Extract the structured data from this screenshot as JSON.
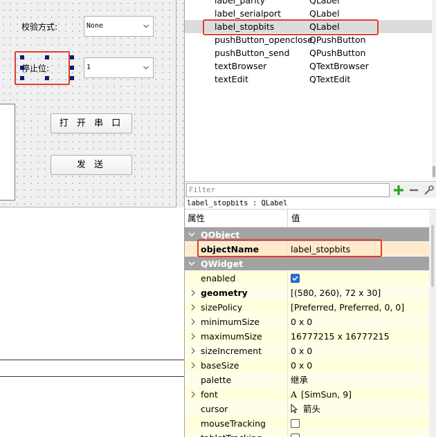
{
  "form": {
    "parity_label": "校验方式:",
    "parity_value": "None",
    "stopbits_label": "停止位:",
    "stopbits_value": "1",
    "open_button": "打 开 串 口",
    "send_button": "发 送"
  },
  "object_inspector": {
    "rows": [
      {
        "name": "label_parity",
        "class": "QLabel"
      },
      {
        "name": "label_serialport",
        "class": "QLabel"
      },
      {
        "name": "label_stopbits",
        "class": "QLabel"
      },
      {
        "name": "pushButton_openclose",
        "class": "QPushButton"
      },
      {
        "name": "pushButton_send",
        "class": "QPushButton"
      },
      {
        "name": "textBrowser",
        "class": "QTextBrowser"
      },
      {
        "name": "textEdit",
        "class": "QTextEdit"
      }
    ],
    "selected_index": 2
  },
  "filter": {
    "placeholder": "Filter"
  },
  "class_label": "label_stopbits : QLabel",
  "property_editor": {
    "header_property": "属性",
    "header_value": "值",
    "group_qobject": "QObject",
    "objectName": {
      "name": "objectName",
      "value": "label_stopbits"
    },
    "group_qwidget": "QWidget",
    "props": [
      {
        "name": "enabled",
        "value": "",
        "checkbox": true,
        "checked": true
      },
      {
        "name": "geometry",
        "value": "[(580, 260), 72 x 30]",
        "bold": true,
        "expand": true
      },
      {
        "name": "sizePolicy",
        "value": "[Preferred, Preferred, 0, 0]",
        "expand": true
      },
      {
        "name": "minimumSize",
        "value": "0 x 0",
        "expand": true
      },
      {
        "name": "maximumSize",
        "value": "16777215 x 16777215",
        "expand": true
      },
      {
        "name": "sizeIncrement",
        "value": "0 x 0",
        "expand": true
      },
      {
        "name": "baseSize",
        "value": "0 x 0",
        "expand": true
      },
      {
        "name": "palette",
        "value": "继承"
      },
      {
        "name": "font",
        "value": "[SimSun, 9]",
        "expand": true,
        "icon": "A"
      },
      {
        "name": "cursor",
        "value": "箭头",
        "icon": "cursor"
      },
      {
        "name": "mouseTracking",
        "value": "",
        "checkbox": true,
        "checked": false
      },
      {
        "name": "tabletTracking",
        "value": "",
        "checkbox": true,
        "checked": false
      }
    ]
  },
  "colors": {
    "highlight_red": "#e53b30",
    "group_gray": "#a3a3a3",
    "prop_yellow": "#ffffdc",
    "selected_orange": "#ffeacb",
    "checkbox_blue": "#2a6fd1"
  }
}
